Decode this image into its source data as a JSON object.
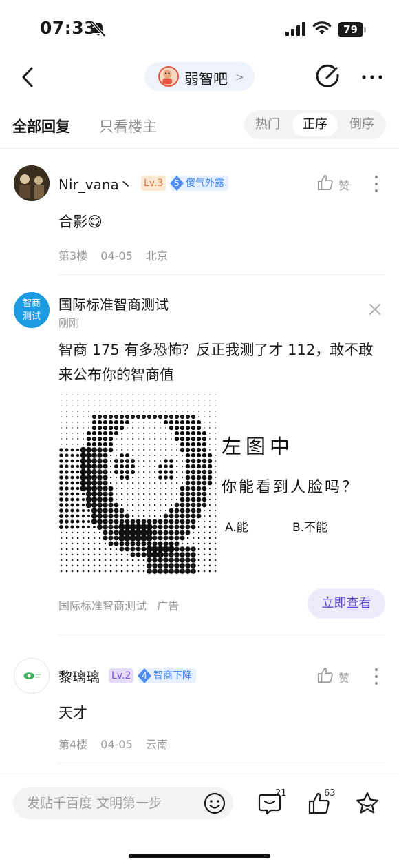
{
  "status_bar": {
    "time": "07:33",
    "battery": "79"
  },
  "nav": {
    "forum_name": "弱智吧"
  },
  "tabs": {
    "all_replies": "全部回复",
    "only_op": "只看楼主"
  },
  "sort": {
    "hot": "热门",
    "ascending": "正序",
    "descending": "倒序",
    "selected": "正序"
  },
  "replies": [
    {
      "username": "Nir_vana丶",
      "level": "Lv.3",
      "badge_num": "5",
      "badge_label": "傻气外露",
      "content": "合影😋",
      "floor": "第3楼",
      "date": "04-05",
      "location": "北京",
      "like_label": "赞"
    },
    {
      "username": "黎璃璃",
      "level": "Lv.2",
      "badge_num": "4",
      "badge_label": "智商下降",
      "content": "天才",
      "floor": "第4楼",
      "date": "04-05",
      "location": "云南",
      "like_label": "赞"
    }
  ],
  "ad": {
    "avatar_text_1": "智商",
    "avatar_text_2": "测试",
    "title": "国际标准智商测试",
    "time": "刚刚",
    "body": "智商 175 有多恐怖？反正我测了才 112，敢不敢来公布你的智商值",
    "image_heading": "左图中",
    "image_question": "你能看到人脸吗？",
    "option_a": "A.能",
    "option_b": "B.不能",
    "source": "国际标准智商测试",
    "ad_label": "广告",
    "cta": "立即查看"
  },
  "bottom_bar": {
    "input_placeholder": "发贴千百度 文明第一步",
    "comment_count": "21",
    "like_count": "63"
  }
}
